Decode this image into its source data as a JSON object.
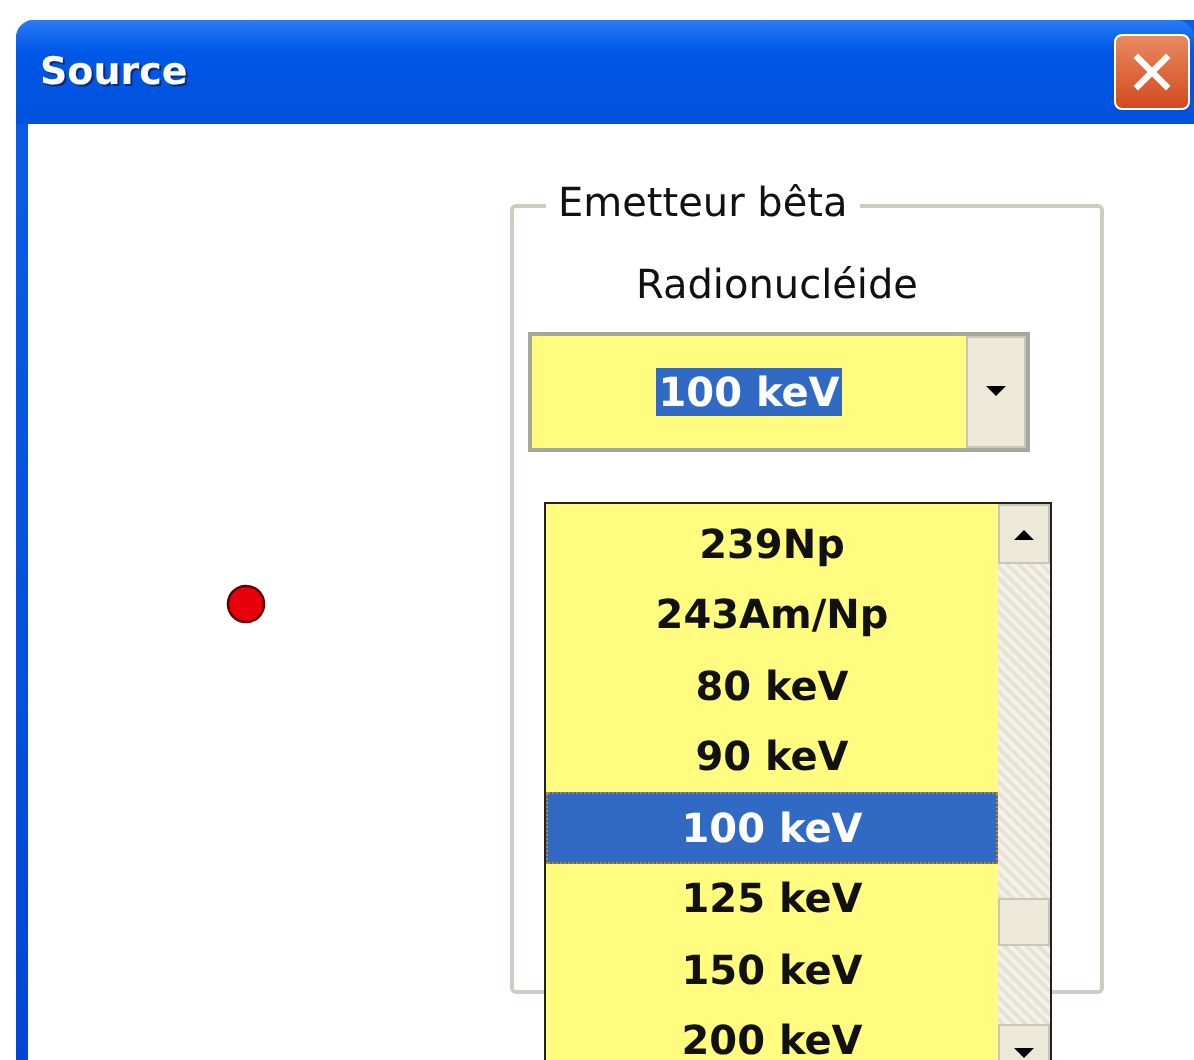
{
  "window": {
    "title": "Source"
  },
  "group": {
    "legend": "Emetteur bêta",
    "label": "Radionucléide"
  },
  "combo": {
    "value": "100 keV"
  },
  "list": {
    "items": [
      {
        "label": "239Np",
        "selected": false
      },
      {
        "label": "243Am/Np",
        "selected": false
      },
      {
        "label": "80 keV",
        "selected": false
      },
      {
        "label": "90 keV",
        "selected": false
      },
      {
        "label": "100 keV",
        "selected": true
      },
      {
        "label": "125 keV",
        "selected": false
      },
      {
        "label": "150 keV",
        "selected": false
      },
      {
        "label": "200 keV",
        "selected": false
      }
    ]
  }
}
